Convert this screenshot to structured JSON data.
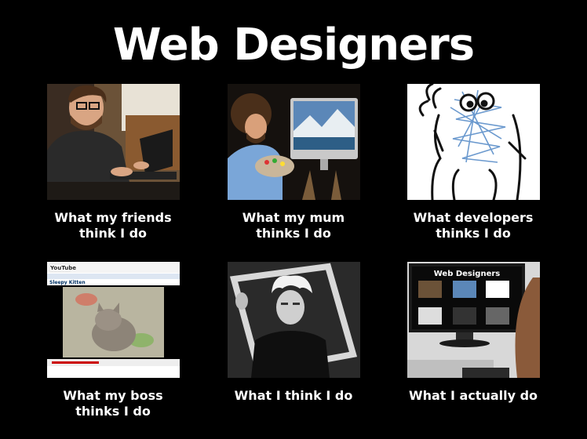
{
  "title": "Web Designers",
  "panels": [
    {
      "caption": "What my friends\nthink I do"
    },
    {
      "caption": "What my mum\nthinks I do"
    },
    {
      "caption": "What developers\nthinks I do"
    },
    {
      "caption": "What my boss\nthinks I do"
    },
    {
      "caption": "What I think I do"
    },
    {
      "caption": "What I actually do"
    }
  ],
  "boss_panel": {
    "site_name": "YouTube",
    "video_title": "Sleepy Kitten"
  },
  "actual_panel": {
    "screen_title": "Web Designers"
  }
}
